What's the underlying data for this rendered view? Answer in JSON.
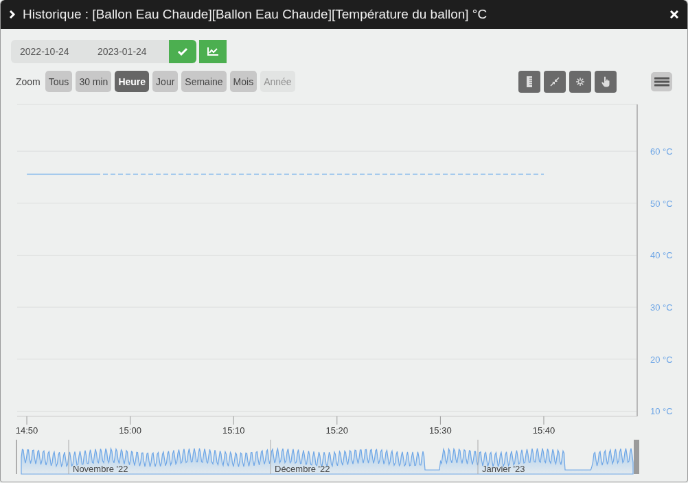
{
  "window": {
    "title": "Historique : [Ballon Eau Chaude][Ballon Eau Chaude][Température du ballon] °C"
  },
  "date_range": {
    "start": "2022-10-24",
    "end": "2023-01-24"
  },
  "zoom": {
    "label": "Zoom",
    "buttons": [
      {
        "label": "Tous",
        "selected": false,
        "disabled": false
      },
      {
        "label": "30 min",
        "selected": false,
        "disabled": false
      },
      {
        "label": "Heure",
        "selected": true,
        "disabled": false
      },
      {
        "label": "Jour",
        "selected": false,
        "disabled": false
      },
      {
        "label": "Semaine",
        "selected": false,
        "disabled": false
      },
      {
        "label": "Mois",
        "selected": false,
        "disabled": false
      },
      {
        "label": "Année",
        "selected": false,
        "disabled": true
      }
    ]
  },
  "chart_data": {
    "type": "line",
    "grid": true,
    "ylim": [
      9,
      69
    ],
    "categories": [
      "14:50",
      "15:00",
      "15:10",
      "15:20",
      "15:30",
      "15:40"
    ],
    "yticks": [
      {
        "value": 10,
        "label": "10 °C"
      },
      {
        "value": 20,
        "label": "20 °C"
      },
      {
        "value": 30,
        "label": "30 °C"
      },
      {
        "value": 40,
        "label": "40 °C"
      },
      {
        "value": 50,
        "label": "50 °C"
      },
      {
        "value": 60,
        "label": "60 °C"
      }
    ],
    "series": [
      {
        "color": "#7cb5ec",
        "line_style": "dashed",
        "values": [
          55.6,
          55.6,
          55.6,
          55.6,
          55.6,
          55.6
        ]
      }
    ]
  },
  "navigator": {
    "labels": [
      "Novembre '22",
      "Décembre '22",
      "Janvier '23"
    ]
  }
}
